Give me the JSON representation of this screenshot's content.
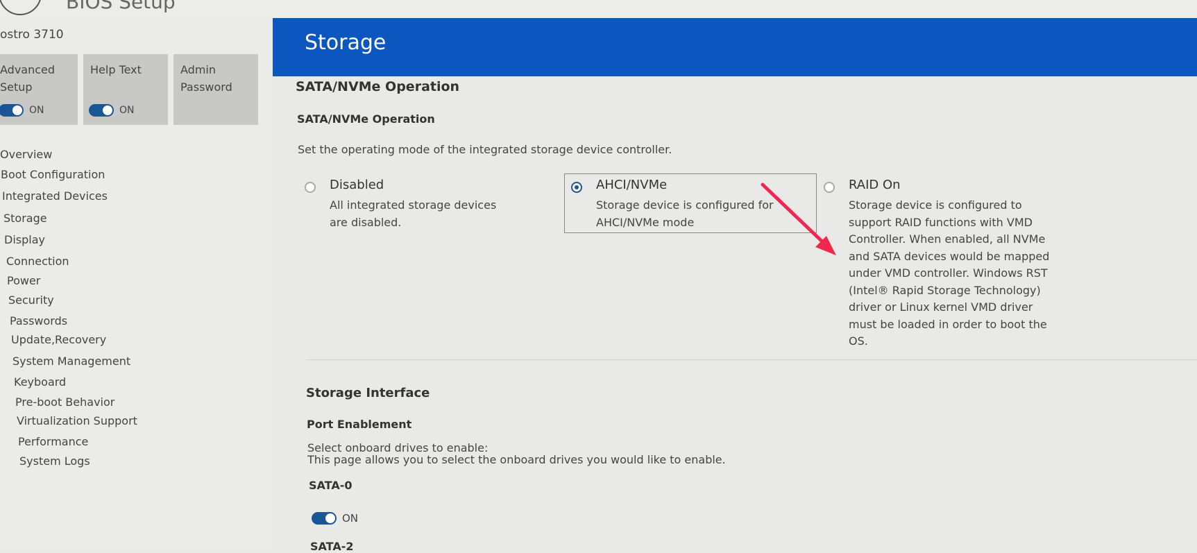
{
  "app": {
    "title": "BIOS Setup"
  },
  "sidebar": {
    "model": "ostro 3710",
    "tiles": [
      {
        "label": "Advanced Setup",
        "toggle_state": "ON"
      },
      {
        "label": "Help Text",
        "toggle_state": "ON"
      },
      {
        "label": "Admin Password"
      }
    ],
    "nav": [
      "Overview",
      "Boot Configuration",
      "Integrated Devices",
      "Storage",
      "Display",
      "Connection",
      "Power",
      "Security",
      "Passwords",
      "Update,Recovery",
      "System Management",
      "Keyboard",
      "Pre-boot Behavior",
      "Virtualization Support",
      "Performance",
      "System Logs"
    ],
    "active": "Storage"
  },
  "header": {
    "title": "Storage"
  },
  "sata": {
    "section_title": "SATA/NVMe Operation",
    "sub_title": "SATA/NVMe Operation",
    "description": "Set the operating mode of the integrated storage device controller.",
    "options": [
      {
        "title": "Disabled",
        "desc": "All integrated storage devices are disabled.",
        "selected": false
      },
      {
        "title": "AHCI/NVMe",
        "desc": "Storage device is configured for AHCI/NVMe mode",
        "selected": true
      },
      {
        "title": "RAID On",
        "desc": "Storage device is configured to support RAID functions with VMD Controller. When enabled, all NVMe and SATA devices would be mapped under VMD controller. Windows RST (Intel® Rapid Storage Technology) driver or Linux kernel VMD driver must be loaded in order to boot the OS.",
        "selected": false
      }
    ]
  },
  "storage_interface": {
    "section_title": "Storage Interface",
    "sub_title": "Port Enablement",
    "line1": "Select onboard drives to enable:",
    "line2": "This page allows you to select the onboard drives you would like to enable.",
    "ports": [
      {
        "name": "SATA-0",
        "toggle_state": "ON"
      },
      {
        "name": "SATA-2"
      }
    ]
  },
  "colors": {
    "header": "#0b56bf",
    "accent": "#1a5596",
    "annotation_arrow": "#f0284e"
  }
}
